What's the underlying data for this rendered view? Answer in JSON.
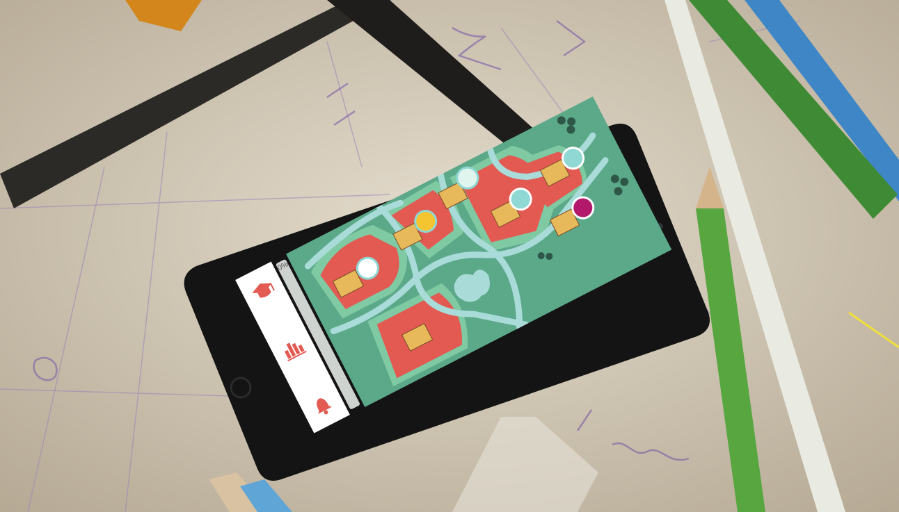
{
  "app": {
    "progress_label": "0%",
    "progress_value": 0,
    "sidebar": [
      {
        "icon": "graduation-cap-icon"
      },
      {
        "icon": "bar-chart-icon"
      },
      {
        "icon": "bell-icon"
      }
    ],
    "map_pins": [
      {
        "icon": "globe-icon",
        "color": "#ffffff"
      },
      {
        "icon": "bell-badge-icon",
        "color": "#f4c431"
      },
      {
        "icon": "dna-icon",
        "color": "#dff5ee"
      },
      {
        "icon": "microbe-icon",
        "color": "#8fd8d3"
      },
      {
        "icon": "person-icon",
        "color": "#8fd8d3"
      },
      {
        "icon": "group-icon",
        "color": "#b3196b"
      }
    ]
  },
  "colors": {
    "map_background": "#5ca98a",
    "land": "#e25a52",
    "road": "#a9dbd9",
    "grass": "#7fc9a3",
    "building": "#e8b95a",
    "sidebar_accent": "#e25a52"
  }
}
